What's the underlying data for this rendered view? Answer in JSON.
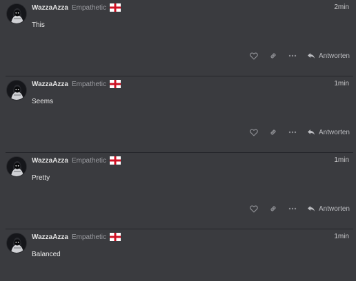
{
  "posts": [
    {
      "username": "WazzaAzza",
      "user_title": "Empathetic",
      "time": "2min",
      "content": "This",
      "reply_label": "Antworten"
    },
    {
      "username": "WazzaAzza",
      "user_title": "Empathetic",
      "time": "1min",
      "content": "Seems",
      "reply_label": "Antworten"
    },
    {
      "username": "WazzaAzza",
      "user_title": "Empathetic",
      "time": "1min",
      "content": "Pretty",
      "reply_label": "Antworten"
    },
    {
      "username": "WazzaAzza",
      "user_title": "Empathetic",
      "time": "1min",
      "content": "Balanced"
    }
  ],
  "icons": {
    "avatar": "avatar-hooded-figure",
    "flag": "england-flag-icon",
    "like": "heart-icon",
    "link": "link-icon",
    "more": "ellipsis-icon",
    "reply": "reply-arrow-icon"
  },
  "colors": {
    "background": "#3a3b3f",
    "divider": "#24252a",
    "muted_text": "#9c9da2",
    "icon": "#8d8e93",
    "flag_red": "#ce1124"
  }
}
